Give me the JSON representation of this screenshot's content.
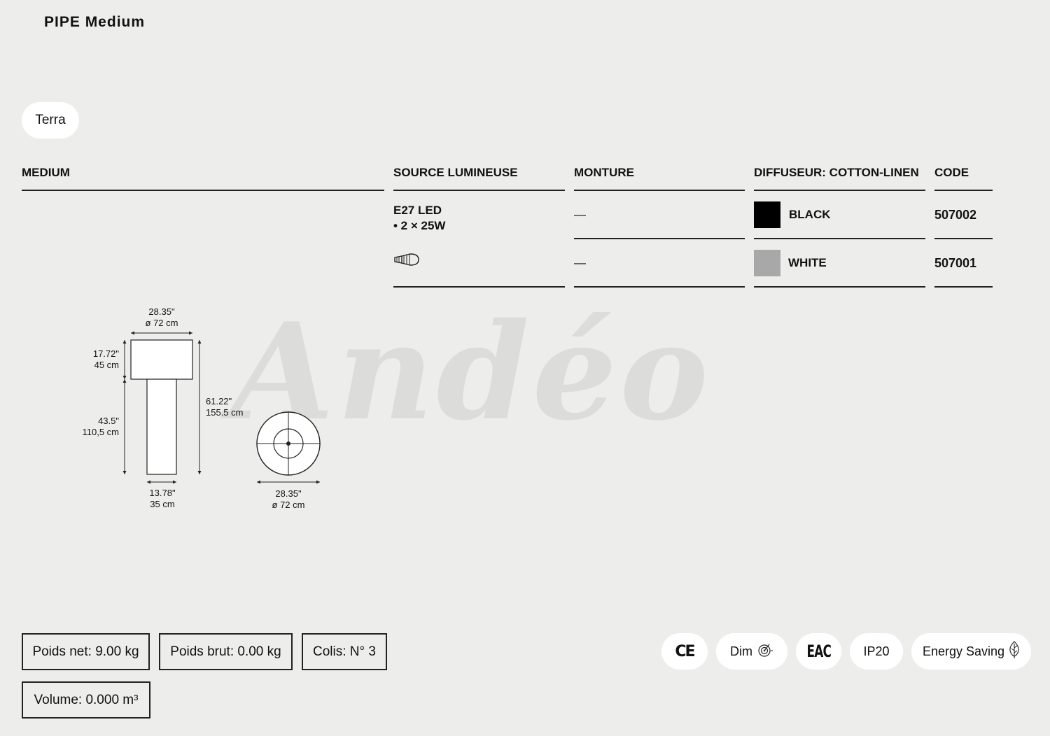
{
  "title": "PIPE Medium",
  "category_pill": "Terra",
  "watermark": "Andéo",
  "table": {
    "headers": {
      "model": "MEDIUM",
      "source": "SOURCE LUMINEUSE",
      "monture": "MONTURE",
      "diffuseur": "DIFFUSEUR: COTTON-LINEN",
      "code": "CODE"
    },
    "source_line1": "E27 LED",
    "source_line2": "• 2 × 25W",
    "bulb_icon": "led-bulb-icon",
    "rows": [
      {
        "monture": "—",
        "diffuseur": "BLACK",
        "color": "#000000",
        "code": "507002"
      },
      {
        "monture": "—",
        "diffuseur": "WHITE",
        "color": "#a8a8a8",
        "code": "507001"
      }
    ]
  },
  "dimensions": {
    "top_width_in": "28.35\"",
    "top_width_cm": "ø 72 cm",
    "shade_height_in": "17.72\"",
    "shade_height_cm": "45 cm",
    "base_height_in": "43.5\"",
    "base_height_cm": "110,5 cm",
    "total_height_in": "61.22\"",
    "total_height_cm": "155.5 cm",
    "base_width_in": "13.78\"",
    "base_width_cm": "35 cm",
    "plan_width_in": "28.35\"",
    "plan_width_cm": "ø 72 cm"
  },
  "specs": {
    "poids_net": "Poids net: 9.00 kg",
    "poids_brut": "Poids brut: 0.00 kg",
    "colis": "Colis: N° 3",
    "volume": "Volume: 0.000 m³"
  },
  "badges": {
    "ce": "CE",
    "dim": "Dim",
    "eac": "EAC",
    "ip": "IP20",
    "energy": "Energy Saving"
  }
}
